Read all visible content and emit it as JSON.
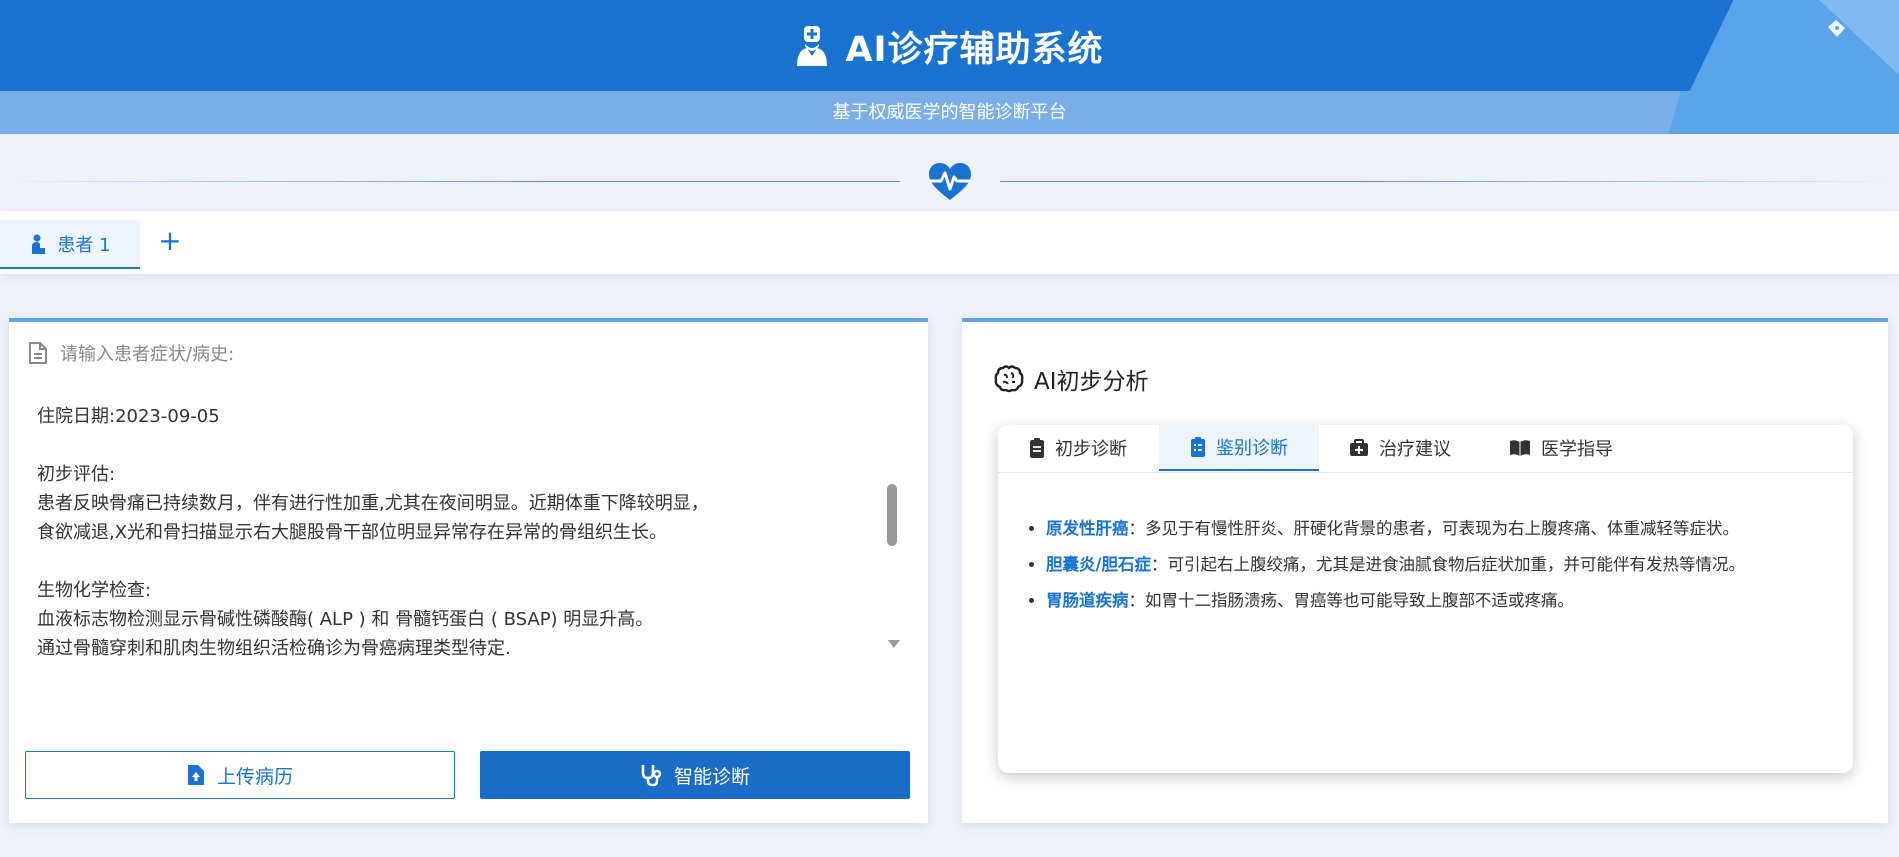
{
  "header": {
    "title": "AI诊疗辅助系统",
    "subtitle": "基于权威医学的智能诊断平台"
  },
  "patient_tabs": [
    {
      "label": "患者 1",
      "active": true
    }
  ],
  "add_tab_label": "+",
  "input": {
    "label": "请输入患者症状/病史:",
    "text": "住院日期:2023-09-05\n\n初步评估:\n患者反映骨痛已持续数月，伴有进行性加重,尤其在夜间明显。近期体重下降较明显，\n食欲减退,X光和骨扫描显示右大腿股骨干部位明显异常存在异常的骨组织生长。\n\n生物化学检查:\n血液标志物检测显示骨碱性磷酸酶( ALP ) 和 骨髓钙蛋白 ( BSAP) 明显升高。\n通过骨髓穿刺和肌肉生物组织活检确诊为骨癌病理类型待定."
  },
  "buttons": {
    "upload": "上传病历",
    "diagnose": "智能诊断"
  },
  "analysis": {
    "title": "AI初步分析",
    "tabs": [
      {
        "label": "初步诊断",
        "icon": "clipboard-icon"
      },
      {
        "label": "鉴别诊断",
        "icon": "clipboard-list-icon"
      },
      {
        "label": "治疗建议",
        "icon": "medkit-icon"
      },
      {
        "label": "医学指导",
        "icon": "book-icon"
      }
    ],
    "active_tab": "鉴别诊断",
    "differentials": [
      {
        "name": "原发性肝癌",
        "desc": "：多见于有慢性肝炎、肝硬化背景的患者，可表现为右上腹疼痛、体重减轻等症状。"
      },
      {
        "name": "胆囊炎/胆石症",
        "desc": "：可引起右上腹绞痛，尤其是进食油腻食物后症状加重，并可能伴有发热等情况。"
      },
      {
        "name": "胃肠道疾病",
        "desc": "：如胃十二指肠溃疡、胃癌等也可能导致上腹部不适或疼痛。"
      }
    ]
  },
  "colors": {
    "primary": "#1a73d0",
    "header_light": "#7aaee8",
    "background": "#eef1f8"
  }
}
